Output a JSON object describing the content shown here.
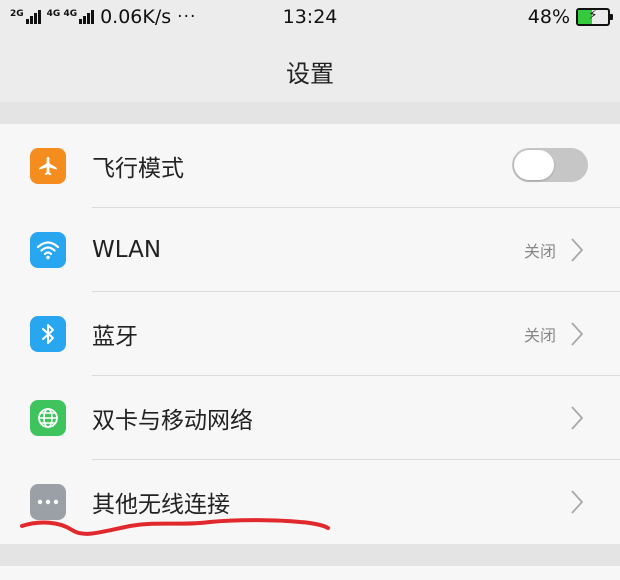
{
  "status_bar": {
    "sim1_label": "2G",
    "sim2_label": "4G 4G",
    "net_speed": "0.06K/s",
    "more": "···",
    "time": "13:24",
    "battery_percent": "48%",
    "battery_level": 0.48,
    "battery_charging_glyph": "⚡"
  },
  "header": {
    "title": "设置"
  },
  "colors": {
    "airplane_icon_bg": "#f58c1e",
    "wlan_icon_bg": "#29a6f0",
    "bluetooth_icon_bg": "#29a6f0",
    "mobile_network_icon_bg": "#3fc35d",
    "other_wireless_icon_bg": "#9aa0a6",
    "annotation_stroke": "#e0282d"
  },
  "settings": {
    "items": [
      {
        "icon": "airplane-icon",
        "label": "飞行模式",
        "control": "toggle",
        "toggle_on": false
      },
      {
        "icon": "wifi-icon",
        "label": "WLAN",
        "status": "关闭",
        "control": "chevron"
      },
      {
        "icon": "bluetooth-icon",
        "label": "蓝牙",
        "status": "关闭",
        "control": "chevron"
      },
      {
        "icon": "globe-icon",
        "label": "双卡与移动网络",
        "control": "chevron"
      },
      {
        "icon": "more-icon",
        "label": "其他无线连接",
        "control": "chevron"
      }
    ]
  }
}
